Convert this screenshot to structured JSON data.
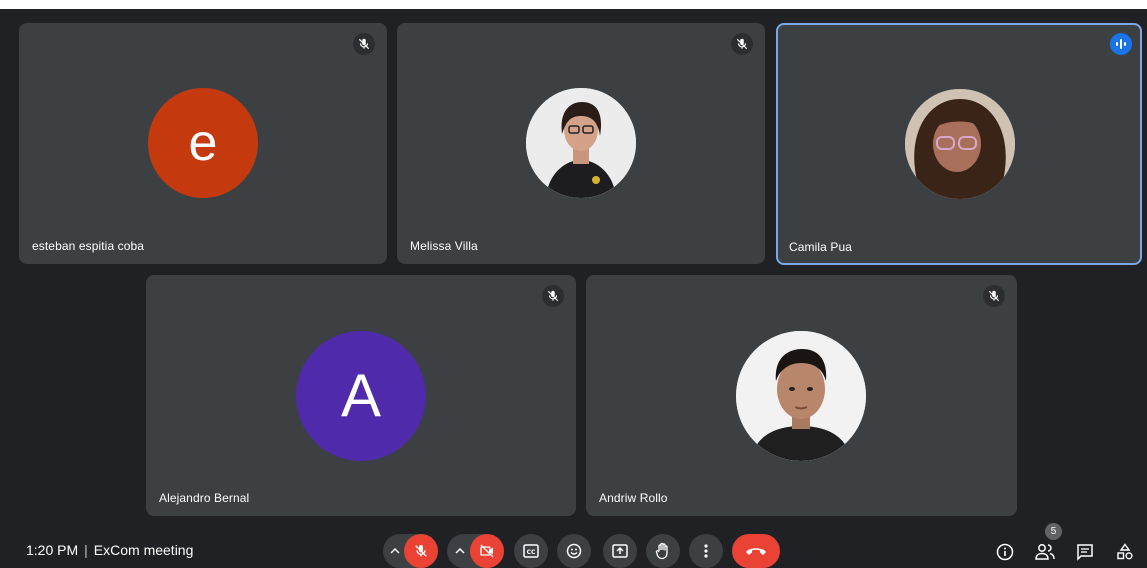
{
  "participants": [
    {
      "name": "esteban espitia coba",
      "initial": "e",
      "avatar_color": "#c5390f",
      "muted": true
    },
    {
      "name": "Melissa Villa",
      "muted": true
    },
    {
      "name": "Camila Pua",
      "muted": false,
      "speaking": true
    },
    {
      "name": "Alejandro Bernal",
      "initial": "A",
      "avatar_color": "#4f2bab",
      "muted": true
    },
    {
      "name": "Andriw Rollo",
      "muted": true
    }
  ],
  "meeting": {
    "time": "1:20 PM",
    "separator": "|",
    "title": "ExCom meeting"
  },
  "people_count": "5",
  "colors": {
    "background": "#202124",
    "tile": "#3c4043",
    "red": "#ea4335",
    "active_border": "#7aa7e8",
    "speaking_blue": "#1a73e8"
  },
  "icons": {
    "mic": "mic-off-icon",
    "camera": "camera-off-icon",
    "captions": "closed-captions-icon",
    "reactions": "emoji-icon",
    "present": "present-screen-icon",
    "hand": "raise-hand-icon",
    "more": "more-options-icon",
    "end": "end-call-icon",
    "info": "info-icon",
    "people": "people-icon",
    "chat": "chat-icon",
    "activities": "activities-icon"
  }
}
